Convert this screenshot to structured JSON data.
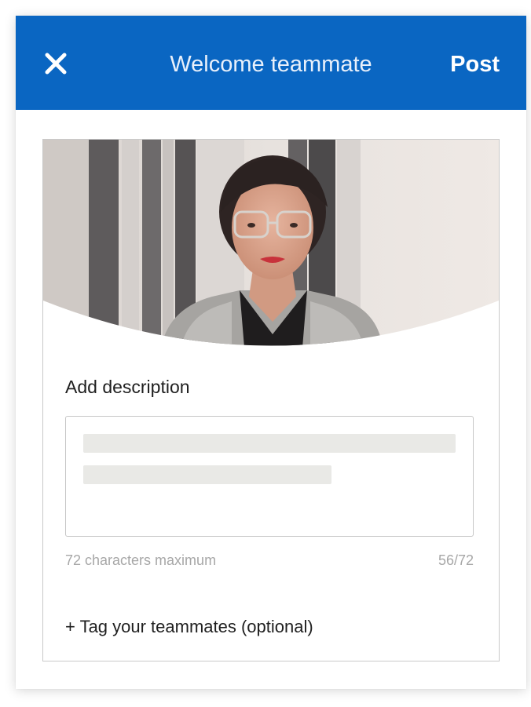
{
  "header": {
    "title": "Welcome teammate",
    "post_label": "Post",
    "close_icon": "close-icon",
    "background_color": "#0a66c2"
  },
  "photo": {
    "description_icon": "profile-photo"
  },
  "description": {
    "label": "Add description",
    "helper_text": "72 characters maximum",
    "counter": "56/72"
  },
  "tag": {
    "label": "+ Tag your teammates (optional)"
  }
}
